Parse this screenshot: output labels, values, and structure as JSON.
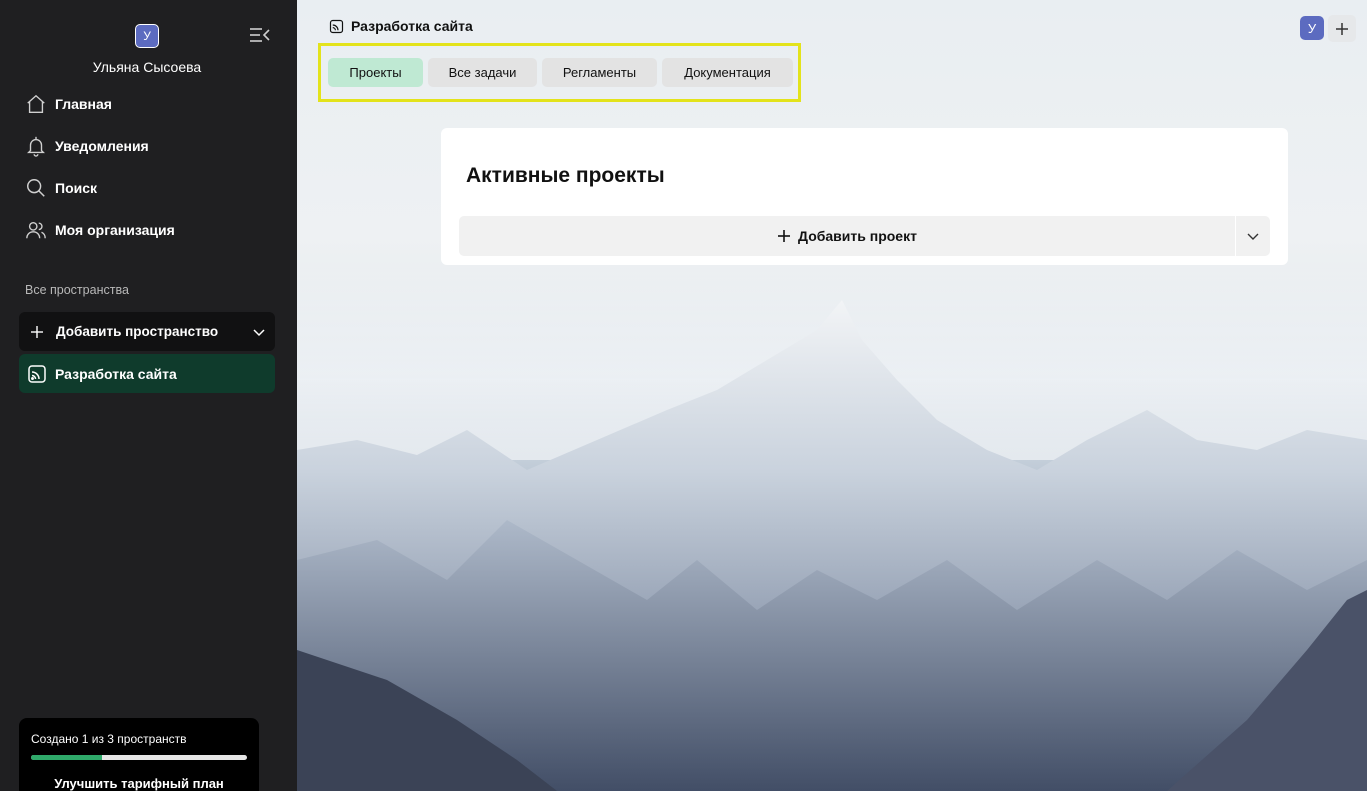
{
  "sidebar": {
    "avatar_letter": "У",
    "username": "Ульяна Сысоева",
    "nav": [
      {
        "label": "Главная",
        "icon": "home-icon"
      },
      {
        "label": "Уведомления",
        "icon": "bell-icon"
      },
      {
        "label": "Поиск",
        "icon": "search-icon"
      },
      {
        "label": "Моя организация",
        "icon": "users-icon"
      }
    ],
    "section_label": "Все пространства",
    "add_space_label": "Добавить пространство",
    "space_item_label": "Разработка сайта",
    "plan": {
      "text": "Создано 1 из 3 пространств",
      "progress": 0.33,
      "upgrade_label": "Улучшить тарифный план"
    }
  },
  "header": {
    "title": "Разработка сайта",
    "avatar_letter": "У",
    "tabs": [
      {
        "label": "Проекты",
        "active": true
      },
      {
        "label": "Все задачи",
        "active": false
      },
      {
        "label": "Регламенты",
        "active": false
      },
      {
        "label": "Документация",
        "active": false
      }
    ]
  },
  "main": {
    "card_title": "Активные проекты",
    "add_project_label": "Добавить проект"
  },
  "colors": {
    "sidebar_bg": "#1f1f21",
    "active_space_bg": "#0f3b2c",
    "active_tab_bg": "#bfe9d3",
    "tabs_highlight_border": "#e3e31b",
    "avatar_bg": "#5c6bc0",
    "progress_fill": "#2fa96a"
  }
}
